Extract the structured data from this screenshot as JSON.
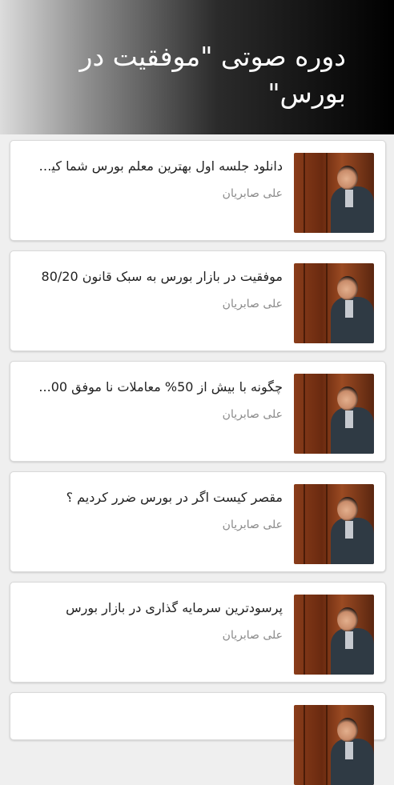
{
  "header": {
    "title": "دوره صوتی \"موفقیت در بورس\""
  },
  "items": [
    {
      "title": "دانلود جلسه اول بهترین معلم بورس شما کیست",
      "author": "علی صابریان"
    },
    {
      "title": "موفقیت در بازار بورس به سبک قانون 80/20",
      "author": "علی صابریان"
    },
    {
      "title": "چگونه با بیش از 50% معاملات نا موفق 00...",
      "author": "علی صابریان"
    },
    {
      "title": "مقصر کیست اگر در بورس ضرر کردیم ؟",
      "author": "علی صابریان"
    },
    {
      "title": "پرسودترین سرمایه گذاری در بازار بورس",
      "author": "علی صابریان"
    }
  ]
}
